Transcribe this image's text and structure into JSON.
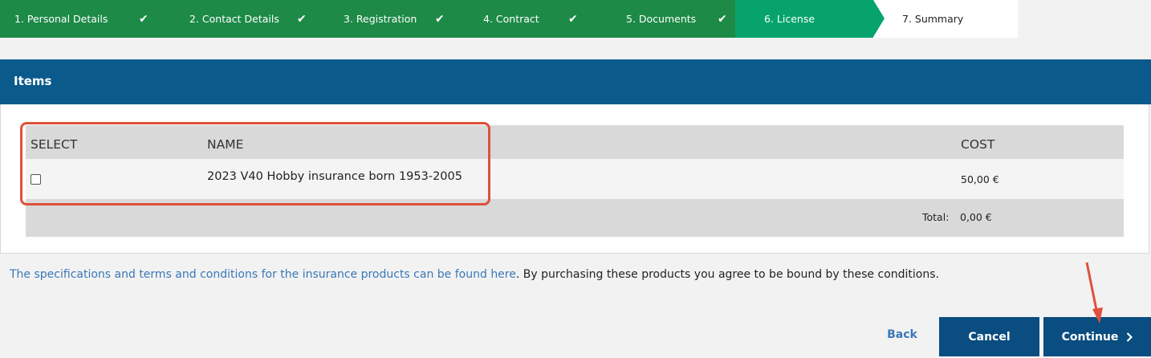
{
  "stepper": {
    "steps": [
      {
        "label": "1. Personal Details",
        "state": "done"
      },
      {
        "label": "2. Contact Details",
        "state": "done"
      },
      {
        "label": "3. Registration",
        "state": "done"
      },
      {
        "label": "4. Contract",
        "state": "done"
      },
      {
        "label": "5. Documents",
        "state": "done"
      },
      {
        "label": "6. License",
        "state": "active"
      },
      {
        "label": "7. Summary",
        "state": "todo"
      }
    ],
    "check_glyph": "✔"
  },
  "panel": {
    "title": "Items"
  },
  "table": {
    "headers": {
      "select": "SELECT",
      "name": "NAME",
      "cost": "COST"
    },
    "rows": [
      {
        "selected": false,
        "name": "2023 V40 Hobby insurance born 1953-2005",
        "cost": "50,00 €"
      }
    ],
    "total_label": "Total:",
    "total_value": "0,00 €"
  },
  "terms": {
    "link_text": "The specifications and terms and conditions for the insurance products can be found here",
    "rest_text": ". By purchasing these products you agree to be bound by these conditions."
  },
  "actions": {
    "back_label": "Back",
    "cancel_label": "Cancel",
    "continue_label": "Continue",
    "continue_icon": "chevron-right-icon"
  },
  "colors": {
    "step_done": "#1d8a47",
    "step_active": "#06a46c",
    "header_blue": "#0a5a8c",
    "button_blue": "#0a4d80",
    "link_blue": "#3a78b8",
    "highlight_red": "#e0503c"
  }
}
